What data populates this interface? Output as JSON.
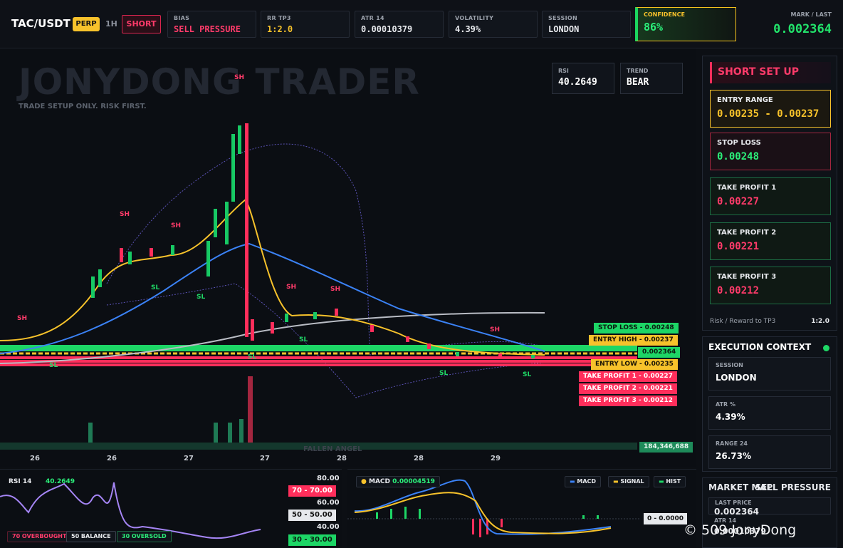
{
  "header": {
    "symbol": "TAC/USDT",
    "badge": "PERP",
    "timeframe": "1H",
    "direction": "SHORT",
    "stats": [
      {
        "label": "BIAS",
        "value": "SELL PRESSURE",
        "color": "#ff3b6a"
      },
      {
        "label": "RR TP3",
        "value": "1:2.0",
        "color": "#f7c22b"
      },
      {
        "label": "ATR 14",
        "value": "0.00010379",
        "color": "#ffffff"
      },
      {
        "label": "VOLATILITY",
        "value": "4.39%",
        "color": "#ffffff"
      },
      {
        "label": "SESSION",
        "value": "LONDON",
        "color": "#ffffff"
      }
    ],
    "confidence_label": "CONFIDENCE",
    "confidence_value": "86%",
    "mark_label": "MARK / LAST",
    "mark_value": "0.002364"
  },
  "chart": {
    "watermark": "JONYDONG TRADER",
    "subtitle": "TRADE SETUP ONLY. RISK FIRST.",
    "rsi_label": "RSI",
    "rsi_value": "40.2649",
    "trend_label": "TREND",
    "trend_value": "BEAR",
    "levels": {
      "stop_loss": "STOP LOSS - 0.00248",
      "entry_high": "ENTRY HIGH - 0.00237",
      "last": "0.002364",
      "entry_low": "ENTRY LOW - 0.00235",
      "tp1": "TAKE PROFIT 1 - 0.00227",
      "tp2": "TAKE PROFIT 2 - 0.00221",
      "tp3": "TAKE PROFIT 3 - 0.00212"
    },
    "volume_value": "184,346,688",
    "x_labels": [
      "26",
      "26",
      "27",
      "27",
      "28",
      "28",
      "29"
    ],
    "sh": "SH",
    "sl": "SL",
    "fallen": "FALLEN ANGEL"
  },
  "setup": {
    "title": "SHORT SET UP",
    "entry_label": "ENTRY RANGE",
    "entry_value": "0.00235 - 0.00237",
    "sl_label": "STOP LOSS",
    "sl_value": "0.00248",
    "tp1_label": "TAKE PROFIT 1",
    "tp1_value": "0.00227",
    "tp2_label": "TAKE PROFIT 2",
    "tp2_value": "0.00221",
    "tp3_label": "TAKE PROFIT 3",
    "tp3_value": "0.00212",
    "rr_label": "Risk / Reward to TP3",
    "rr_value": "1:2.0"
  },
  "execution": {
    "title": "EXECUTION CONTEXT",
    "items": [
      {
        "label": "SESSION",
        "value": "LONDON"
      },
      {
        "label": "ATR %",
        "value": "4.39%"
      },
      {
        "label": "RANGE 24",
        "value": "26.73%"
      }
    ]
  },
  "market_map": {
    "title": "MARKET MAP",
    "state": "SELL PRESSURE",
    "last_label": "LAST PRICE",
    "last_value": "0.002364",
    "atr_label": "ATR 14",
    "atr_value": "0.00010379"
  },
  "rsi_panel": {
    "label": "RSI 14",
    "value": "40.2649",
    "overbought": "70 OVERBOUGHT",
    "balance": "50 BALANCE",
    "oversold": "30 OVERSOLD",
    "y80": "80.00",
    "y70": "70 - 70.00",
    "y60": "60.00",
    "y50": "50 - 50.00",
    "y40": "40.00",
    "y30": "30 - 30.00"
  },
  "macd_panel": {
    "label": "MACD",
    "value": "0.00004519",
    "legend_macd": "MACD",
    "legend_signal": "SIGNAL",
    "legend_hist": "HIST",
    "zero": "0 - 0.0000"
  },
  "credit": "© 509 JonyDong"
}
